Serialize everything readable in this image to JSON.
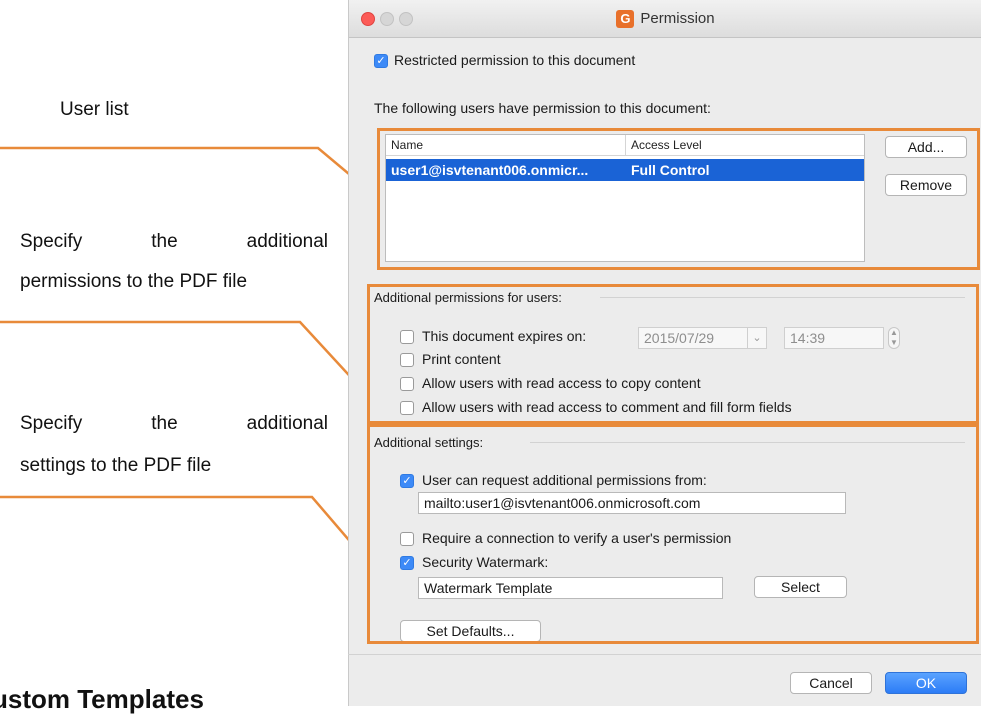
{
  "annotations": {
    "user_list": "User list",
    "perm_line1": "Specify the additional",
    "perm_line2": "permissions to the PDF file",
    "settings_line1": "Specify the additional",
    "settings_line2": "settings to the PDF file"
  },
  "doc_heading": "ustom Templates",
  "window": {
    "title": "Permission",
    "app_icon_glyph": "G"
  },
  "restrict": {
    "checked": true,
    "label": "Restricted permission to this document"
  },
  "users_intro": "The following users have permission to this document:",
  "users_table": {
    "columns": [
      "Name",
      "Access Level"
    ],
    "rows": [
      {
        "name": "user1@isvtenant006.onmicr...",
        "access": "Full Control",
        "selected": true
      }
    ]
  },
  "user_buttons": {
    "add": "Add...",
    "remove": "Remove"
  },
  "additional_permissions": {
    "title": "Additional permissions for users:",
    "expires": {
      "checked": false,
      "label": "This document expires on:",
      "date": "2015/07/29",
      "time": "14:39"
    },
    "print": {
      "checked": false,
      "label": "Print content"
    },
    "copy": {
      "checked": false,
      "label": "Allow users with read access to copy content"
    },
    "comment": {
      "checked": false,
      "label": "Allow users with read access to comment and fill form fields"
    }
  },
  "additional_settings": {
    "title": "Additional settings:",
    "request": {
      "checked": true,
      "label": "User can request additional permissions from:",
      "value": "mailto:user1@isvtenant006.onmicrosoft.com"
    },
    "require_connection": {
      "checked": false,
      "label": "Require a connection to verify a user's permission"
    },
    "watermark": {
      "checked": true,
      "label": "Security Watermark:",
      "value": "Watermark Template",
      "select_label": "Select"
    },
    "set_defaults": "Set Defaults..."
  },
  "footer": {
    "cancel": "Cancel",
    "ok": "OK"
  },
  "colors": {
    "annotation_orange": "#e88a3a",
    "selection_blue": "#1a63d6",
    "checkbox_blue": "#3d8af7"
  }
}
